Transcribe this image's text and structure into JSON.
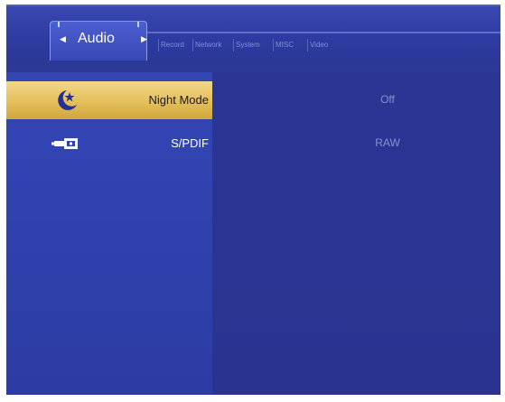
{
  "tabs": {
    "active": "Audio",
    "others": [
      "Record",
      "Network",
      "System",
      "MISC",
      "Video"
    ]
  },
  "settings": [
    {
      "icon": "night-mode-moon-icon",
      "label": "Night Mode",
      "value": "Off",
      "selected": true
    },
    {
      "icon": "spdif-connector-icon",
      "label": "S/PDIF",
      "value": "RAW",
      "selected": false
    }
  ],
  "colors": {
    "background": "#2d3a98",
    "selected_row": "#e4bf5a",
    "text": "#ffffff",
    "value_text": "#9aa3d8"
  }
}
